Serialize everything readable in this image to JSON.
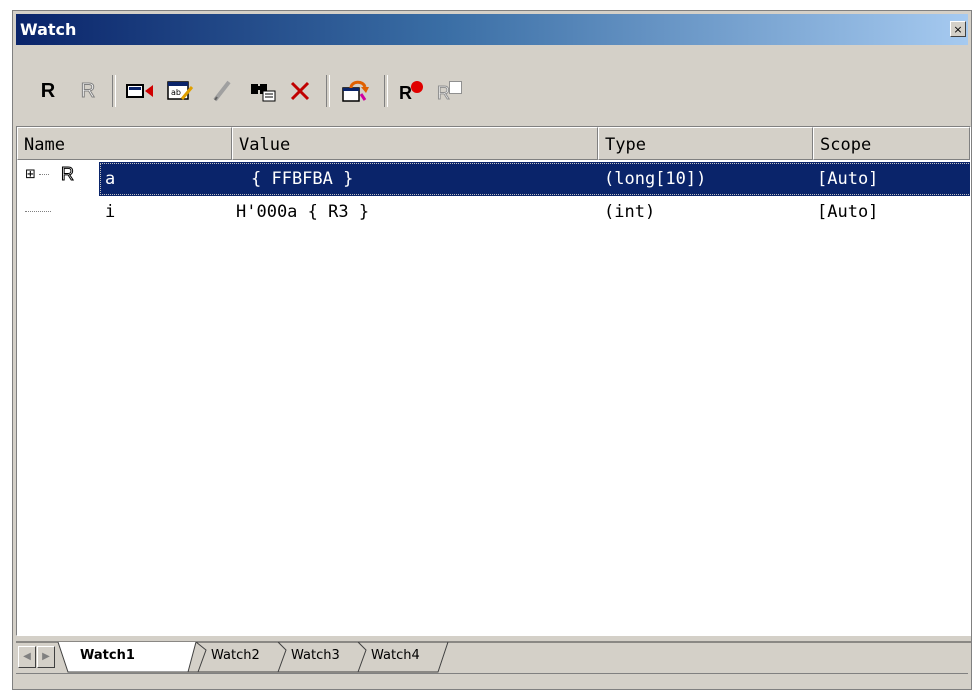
{
  "window": {
    "title": "Watch",
    "close_glyph": "×"
  },
  "toolbar": {
    "buttons": [
      {
        "name": "add-register-watch-icon",
        "glyph": "R"
      },
      {
        "name": "remove-register-watch-icon",
        "glyph": "R"
      },
      {
        "name": "add-watch-icon",
        "glyph": "▭"
      },
      {
        "name": "edit-value-icon",
        "glyph": "ab"
      },
      {
        "name": "edit-pencil-icon",
        "glyph": "✎"
      },
      {
        "name": "find-icon",
        "glyph": "🔍"
      },
      {
        "name": "delete-icon",
        "glyph": "✕"
      },
      {
        "name": "refresh-icon",
        "glyph": "⟳"
      },
      {
        "name": "set-breakpoint-icon",
        "glyph": "R"
      },
      {
        "name": "clear-breakpoint-icon",
        "glyph": "R"
      }
    ]
  },
  "columns": [
    "Name",
    "Value",
    "Type",
    "Scope"
  ],
  "rows": [
    {
      "expander": "⊞",
      "reg": "R",
      "name": "a",
      "value": "{ FFBFBA }",
      "type": "(long[10])",
      "scope": "[Auto]",
      "selected": true
    },
    {
      "expander": "",
      "reg": "",
      "name": "i",
      "value": "H'000a { R3 }",
      "type": "(int)",
      "scope": "[Auto]",
      "selected": false
    }
  ],
  "tabs": [
    "Watch1",
    "Watch2",
    "Watch3",
    "Watch4"
  ],
  "nav": {
    "prev": "◀",
    "next": "▶"
  },
  "colors": {
    "selection": "#0a246a",
    "titlebar": "#0a246a",
    "face": "#d4d0c8"
  }
}
